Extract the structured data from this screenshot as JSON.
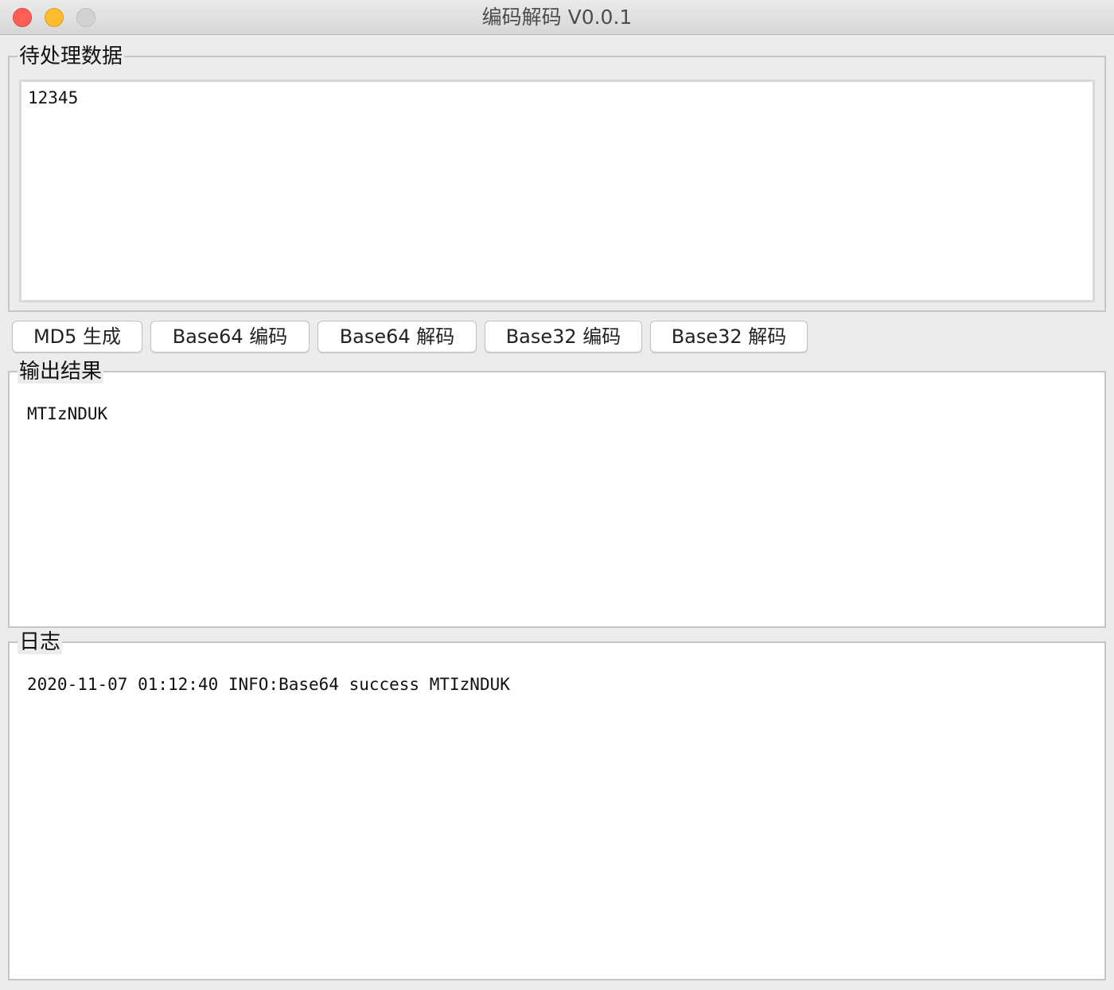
{
  "window": {
    "title": "编码解码 V0.0.1"
  },
  "input_group": {
    "label": "待处理数据",
    "value": "12345"
  },
  "buttons": [
    {
      "label": "MD5 生成"
    },
    {
      "label": "Base64 编码"
    },
    {
      "label": "Base64 解码"
    },
    {
      "label": "Base32 编码"
    },
    {
      "label": "Base32 解码"
    }
  ],
  "output_group": {
    "label": "输出结果",
    "value": "MTIzNDUK"
  },
  "log_group": {
    "label": "日志",
    "entries": [
      "2020-11-07 01:12:40 INFO:Base64 success MTIzNDUK"
    ]
  },
  "colors": {
    "close": "#fd5f57",
    "minimize": "#febc2e",
    "zoom_disabled": "#d2d2d2",
    "window_bg": "#ececec"
  }
}
